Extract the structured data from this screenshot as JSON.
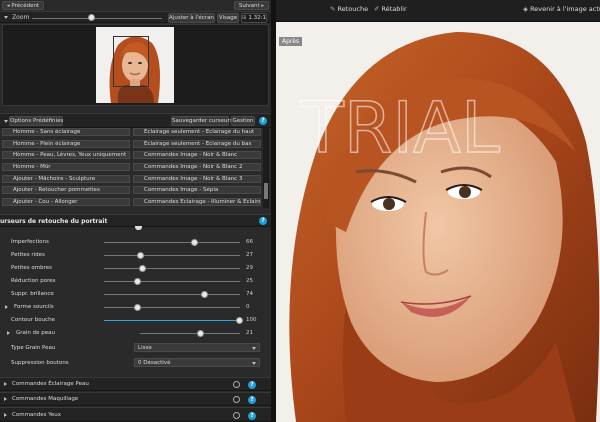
{
  "nav": {
    "prev": "Précédent",
    "next": "Suivant"
  },
  "zoom": {
    "title": "Zoom",
    "fit_label": "Ajuster à l'écran",
    "view_label": "Visage",
    "ratio": "1.32:1"
  },
  "presets": {
    "title": "Options Prédéfinies",
    "save_label": "Sauvegarder curseurs",
    "manage_label": "Gestion",
    "left": [
      "Homme - Sans éclairage",
      "Homme - Plein éclairage",
      "Homme - Peau, Lèvres, Yeux uniquement",
      "Homme - Mûr",
      "Ajouter - Mâchoire - Sculpture",
      "Ajouter - Retoucher pommettes",
      "Ajouter - Cou - Allonger"
    ],
    "right": [
      "Éclairage seulement - Éclairage du haut",
      "Éclairage seulement - Éclairage du bas",
      "Commandes Image - Noir & Blanc",
      "Commandes Image - Noir & Blanc 2",
      "Commandes Image - Noir & Blanc 3",
      "Commandes Image - Sépia",
      "Commandes Éclairage - Illuminer & Éclairer"
    ]
  },
  "sliders_panel": {
    "title": "urseurs de retouche du portrait",
    "sliders": [
      {
        "label": "Imperfections",
        "value": 66
      },
      {
        "label": "Petites rides",
        "value": 27
      },
      {
        "label": "Petites ombres",
        "value": 29
      },
      {
        "label": "Réduction pores",
        "value": 25
      },
      {
        "label": "Suppr. brillance",
        "value": 74
      },
      {
        "label": "Forme sourcils",
        "value": 0
      },
      {
        "label": "Contour bouche",
        "value": 100
      },
      {
        "label": "Grain de peau",
        "value": 21
      }
    ],
    "grain_type_label": "Type Grain Peau",
    "grain_type_value": "Lisse",
    "suppression_label": "Suppression boutons",
    "suppression_value": "0 Désactivé"
  },
  "commands": [
    "Commandes Éclairage Peau",
    "Commandes Maquillage",
    "Commandes Yeux"
  ],
  "toolbar": {
    "retouch": "Retouche",
    "restore": "Rétablir",
    "revert": "Revenir à l'image actuelle"
  },
  "preview": {
    "badge": "Après",
    "watermark": "TRIAL"
  },
  "colors": {
    "accent": "#1e9fd8",
    "panel": "#2a2a2a"
  }
}
